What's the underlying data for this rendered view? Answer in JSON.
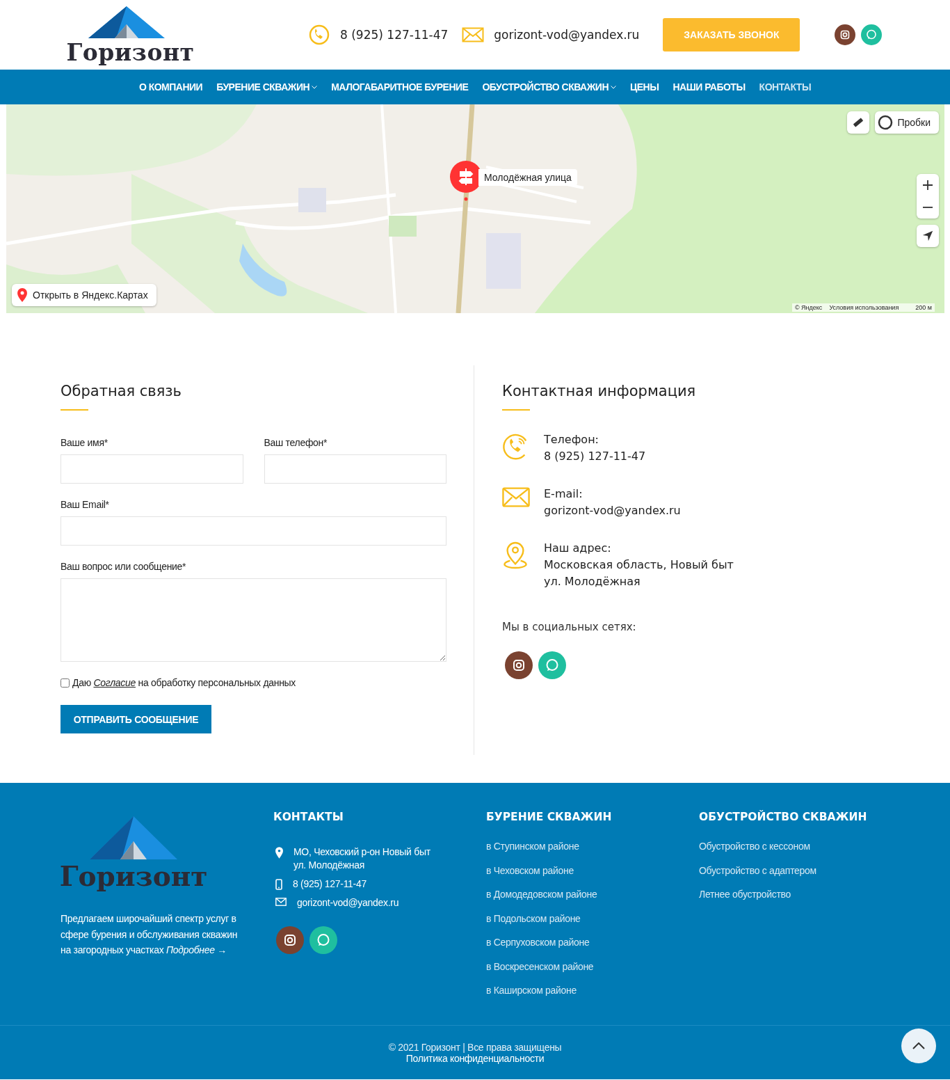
{
  "header": {
    "logo": "Горизонт",
    "phone": "8 (925) 127-11-47",
    "email": "gorizont-vod@yandex.ru",
    "callback_button": "ЗАКАЗАТЬ ЗВОНОК",
    "socials": [
      {
        "kind": "instagram"
      },
      {
        "kind": "whatsapp"
      }
    ]
  },
  "nav": {
    "items": [
      {
        "label": "О КОМПАНИИ",
        "dropdown": false,
        "selected": false
      },
      {
        "label": "БУРЕНИЕ СКВАЖИН",
        "dropdown": true,
        "selected": false
      },
      {
        "label": "МАЛОГАБАРИТНОЕ БУРЕНИЕ",
        "dropdown": false,
        "selected": false
      },
      {
        "label": "ОБУСТРОЙСТВО СКВАЖИН",
        "dropdown": true,
        "selected": false
      },
      {
        "label": "ЦЕНЫ",
        "dropdown": false,
        "selected": false
      },
      {
        "label": "НАШИ РАБОТЫ",
        "dropdown": false,
        "selected": false
      },
      {
        "label": "КОНТАКТЫ",
        "dropdown": false,
        "selected": true
      }
    ]
  },
  "map": {
    "kind": "picture",
    "placemark_label": "Молодёжная улица",
    "traffic_button": "Пробки",
    "open_link": "Открыть в Яндекс.Картах",
    "attribution": "© Яндекс",
    "terms": "Условия использования",
    "scale": "200 м"
  },
  "feedback": {
    "title": "Обратная связь",
    "fields": [
      {
        "label": "Ваше имя*",
        "kind": "half"
      },
      {
        "label": "Ваш телефон*",
        "kind": "half"
      },
      {
        "label": "Ваш Email*",
        "kind": "wide"
      },
      {
        "label": "Ваш вопрос или сообщение*",
        "kind": "textarea"
      }
    ],
    "consent": {
      "checked": false,
      "before": "Даю",
      "link": "Согласие",
      "after": "на обработку персональных данных"
    },
    "submit": "ОТПРАВИТЬ СООБЩЕНИЕ"
  },
  "contact_info": {
    "title": "Контактная информация",
    "items": [
      {
        "kind": "phone",
        "label": "Телефон:",
        "lines": [
          "8 (925) 127-11-47"
        ]
      },
      {
        "kind": "email",
        "label": "E-mail:",
        "lines": [
          "gorizont-vod@yandex.ru"
        ]
      },
      {
        "kind": "address",
        "label": "Наш адрес:",
        "lines": [
          "Московская область, Новый быт",
          "ул. Молодёжная"
        ]
      }
    ],
    "social_title": "Мы в социальных сетях:",
    "socials": [
      {
        "kind": "instagram"
      },
      {
        "kind": "whatsapp"
      }
    ]
  },
  "footer": {
    "logo": "Горизонт",
    "description": "Предлагаем широчайший спектр услуг в сфере бурения и обслуживания скважин на загородных участках",
    "more_link": "Подробнее →",
    "contacts": {
      "title": "КОНТАКТЫ",
      "items": [
        {
          "kind": "address",
          "lines": [
            "МО, Чеховский р-он Новый быт",
            "ул. Молодёжная"
          ]
        },
        {
          "kind": "phone",
          "lines": [
            "8 (925) 127-11-47"
          ]
        },
        {
          "kind": "email",
          "lines": [
            "gorizont-vod@yandex.ru"
          ]
        }
      ],
      "socials": [
        {
          "kind": "instagram"
        },
        {
          "kind": "whatsapp"
        }
      ]
    },
    "columns": [
      {
        "title": "БУРЕНИЕ СКВАЖИН",
        "links": [
          "в Ступинском районе",
          "в Чеховском районе",
          "в Домодедовском районе",
          "в Подольском районе",
          "в Серпуховском районе",
          "в Воскресенском районе",
          "в Каширском районе"
        ]
      },
      {
        "title": "ОБУСТРОЙСТВО СКВАЖИН",
        "links": [
          "Обустройство с кессоном",
          "Обустройство с адаптером",
          "Летнее обустройство"
        ]
      }
    ],
    "copyright": "© 2021 Горизонт | Все права защищены",
    "policy": "Политика конфиденциальности"
  }
}
